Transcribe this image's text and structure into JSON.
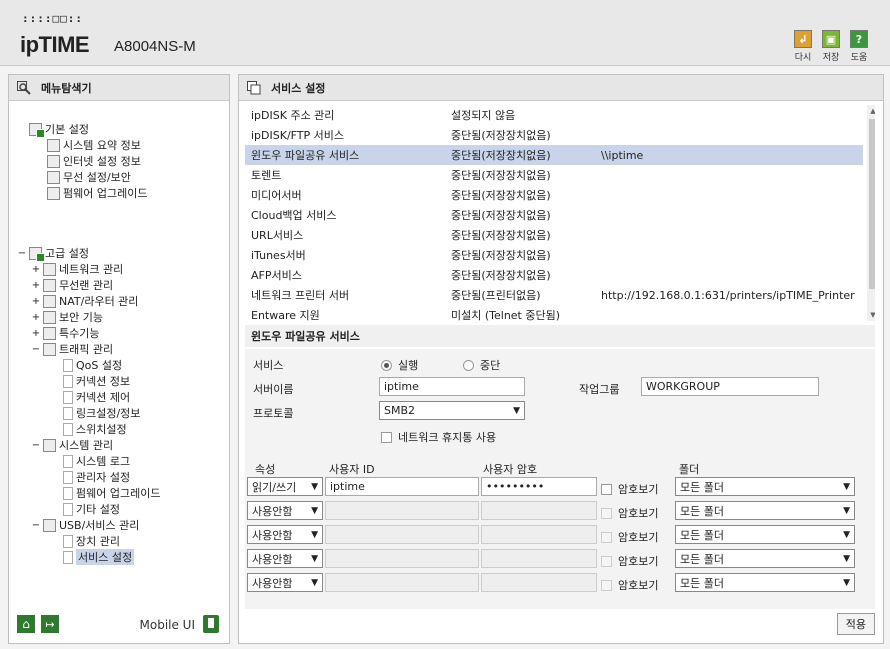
{
  "header": {
    "logo_grid": "::::□□::",
    "brand": "ipTIME",
    "model": "A8004NS-M",
    "tools": [
      {
        "label": "다시",
        "icon": "refresh-icon",
        "color": "#e0a030"
      },
      {
        "label": "저장",
        "icon": "save-icon",
        "color": "#7ab830"
      },
      {
        "label": "도움",
        "icon": "help-icon",
        "color": "#3a9a3a",
        "glyph": "?"
      }
    ]
  },
  "sidebar": {
    "title": "메뉴탐색기",
    "basic": {
      "label": "기본 설정",
      "items": [
        "시스템 요약 정보",
        "인터넷 설정 정보",
        "무선 설정/보안",
        "펌웨어 업그레이드"
      ]
    },
    "advanced": {
      "label": "고급 설정",
      "items": [
        {
          "label": "네트워크 관리",
          "exp": "+"
        },
        {
          "label": "무선랜 관리",
          "exp": "+"
        },
        {
          "label": "NAT/라우터 관리",
          "exp": "+"
        },
        {
          "label": "보안 기능",
          "exp": "+"
        },
        {
          "label": "특수기능",
          "exp": "+"
        },
        {
          "label": "트래픽 관리",
          "exp": "−"
        },
        {
          "label": "QoS 설정",
          "exp": ""
        },
        {
          "label": "커넥션 정보",
          "exp": ""
        },
        {
          "label": "커넥션 제어",
          "exp": ""
        },
        {
          "label": "링크설정/정보",
          "exp": ""
        },
        {
          "label": "스위치설정",
          "exp": ""
        },
        {
          "label": "시스템 관리",
          "exp": "−"
        },
        {
          "label": "시스템 로그",
          "exp": ""
        },
        {
          "label": "관리자 설정",
          "exp": ""
        },
        {
          "label": "펌웨어 업그레이드",
          "exp": ""
        },
        {
          "label": "기타 설정",
          "exp": ""
        },
        {
          "label": "USB/서비스 관리",
          "exp": "−"
        },
        {
          "label": "장치 관리",
          "exp": ""
        },
        {
          "label": "서비스 설정",
          "exp": ""
        }
      ]
    },
    "mobile_label": "Mobile UI"
  },
  "main": {
    "title": "서비스 설정",
    "services": [
      {
        "name": "ipDISK 주소 관리",
        "status": "설정되지 않음",
        "info": ""
      },
      {
        "name": "ipDISK/FTP 서비스",
        "status": "중단됨(저장장치없음)",
        "info": ""
      },
      {
        "name": "윈도우 파일공유 서비스",
        "status": "중단됨(저장장치없음)",
        "info": "\\\\iptime"
      },
      {
        "name": "토렌트",
        "status": "중단됨(저장장치없음)",
        "info": ""
      },
      {
        "name": "미디어서버",
        "status": "중단됨(저장장치없음)",
        "info": ""
      },
      {
        "name": "Cloud백업 서비스",
        "status": "중단됨(저장장치없음)",
        "info": ""
      },
      {
        "name": "URL서비스",
        "status": "중단됨(저장장치없음)",
        "info": ""
      },
      {
        "name": "iTunes서버",
        "status": "중단됨(저장장치없음)",
        "info": ""
      },
      {
        "name": "AFP서비스",
        "status": "중단됨(저장장치없음)",
        "info": ""
      },
      {
        "name": "네트워크 프린터 서버",
        "status": "중단됨(프린터없음)",
        "info": "http://192.168.0.1:631/printers/ipTIME_Printer"
      },
      {
        "name": "Entware 지원",
        "status": "미설치 (Telnet 중단됨)",
        "info": ""
      }
    ],
    "detail": {
      "title": "윈도우 파일공유 서비스",
      "service_label": "서비스",
      "run_label": "실행",
      "stop_label": "중단",
      "server_name_label": "서버이름",
      "server_name": "iptime",
      "workgroup_label": "작업그룹",
      "workgroup": "WORKGROUP",
      "protocol_label": "프로토콜",
      "protocol": "SMB2",
      "recycle_label": "네트워크 휴지통 사용",
      "col_attr": "속성",
      "col_user": "사용자 ID",
      "col_pass": "사용자 암호",
      "col_folder": "폴더",
      "show_pass_label": "암호보기",
      "accounts": [
        {
          "attr": "읽기/쓰기",
          "user": "iptime",
          "pass": "•••••••••",
          "folder": "모든 폴더"
        },
        {
          "attr": "사용안함",
          "user": "",
          "pass": "",
          "folder": "모든 폴더"
        },
        {
          "attr": "사용안함",
          "user": "",
          "pass": "",
          "folder": "모든 폴더"
        },
        {
          "attr": "사용안함",
          "user": "",
          "pass": "",
          "folder": "모든 폴더"
        },
        {
          "attr": "사용안함",
          "user": "",
          "pass": "",
          "folder": "모든 폴더"
        }
      ],
      "apply_label": "적용"
    }
  }
}
